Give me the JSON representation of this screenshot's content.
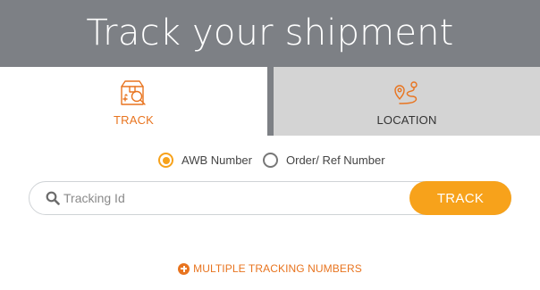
{
  "header": {
    "title": "Track your shipment"
  },
  "tabs": [
    {
      "label": "TRACK",
      "icon": "package-search-icon",
      "active": true
    },
    {
      "label": "LOCATION",
      "icon": "route-pin-icon",
      "active": false
    }
  ],
  "lookup_type": {
    "options": [
      "AWB Number",
      "Order/ Ref Number"
    ],
    "selected": "AWB Number"
  },
  "search": {
    "placeholder": "Tracking Id",
    "value": ""
  },
  "track_button": {
    "label": "TRACK"
  },
  "multiple_link": {
    "label": "MULTIPLE TRACKING NUMBERS",
    "icon": "plus-circle-icon"
  },
  "colors": {
    "header_bg": "#7d8085",
    "accent_orange": "#f7a21b",
    "link_orange": "#e8741f",
    "inactive_tab_bg": "#d4d4d4"
  }
}
